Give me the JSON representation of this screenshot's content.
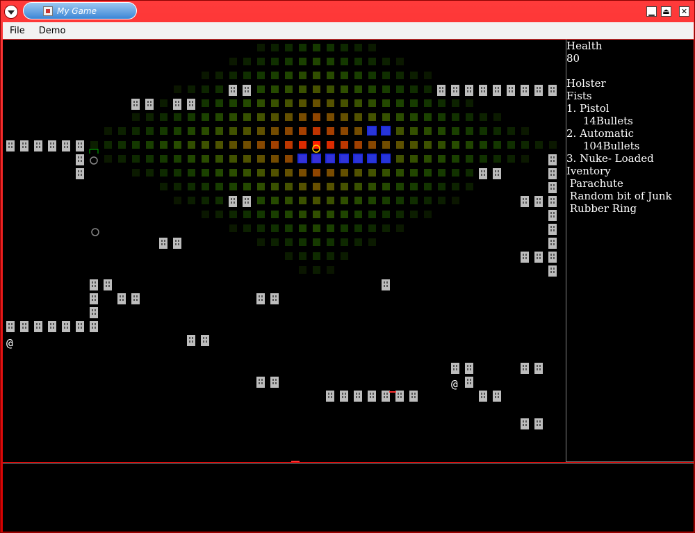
{
  "window": {
    "title": "My Game",
    "menus": [
      "File",
      "Demo"
    ]
  },
  "side_panel": {
    "lines": [
      "Health",
      "80",
      "",
      "Holster",
      "Fists",
      "1. Pistol",
      "     14Bullets",
      "2. Automatic",
      "     104Bullets",
      "3. Nuke- Loaded",
      "Iventory",
      " Parachute",
      " Random bit of Junk",
      " Rubber Ring"
    ]
  },
  "game": {
    "player_glyph": "@",
    "colors": {
      "wall": "#bdbdbd",
      "background": "#000000",
      "blast_core": "#ff2000",
      "blast_edge": "#1a3a00",
      "selection": "#2030ff",
      "enemy": "#888888",
      "marker": "#00c000"
    }
  }
}
